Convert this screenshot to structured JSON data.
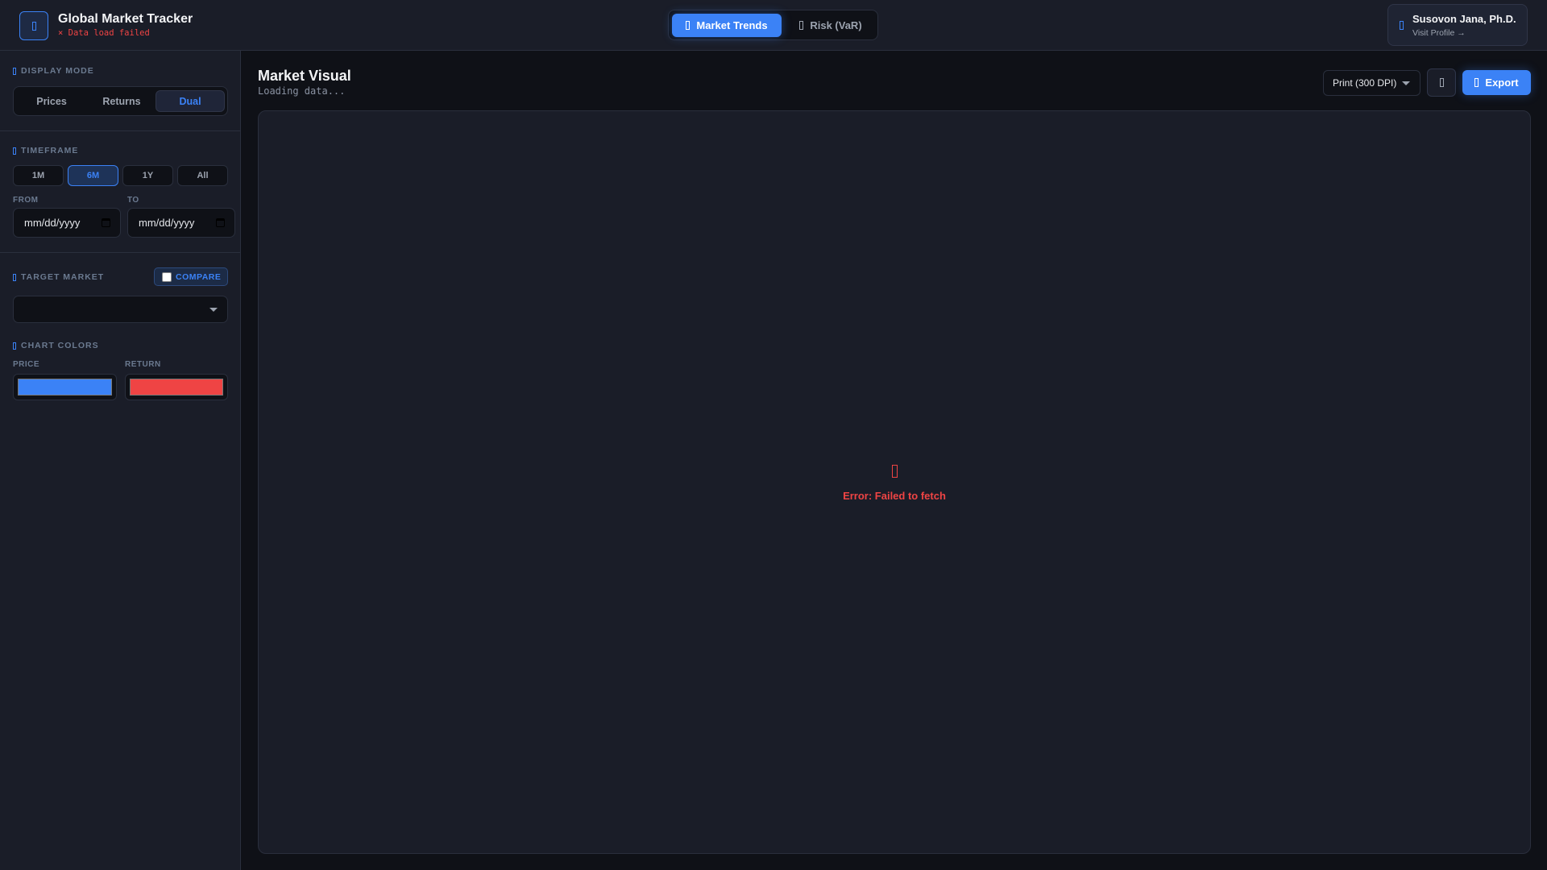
{
  "header": {
    "logo_icon": "chart-icon",
    "title": "Global Market Tracker",
    "status": "× Data load failed",
    "tabs": [
      {
        "label": "Market Trends",
        "icon": "trend-icon",
        "active": true
      },
      {
        "label": "Risk (VaR)",
        "icon": "shield-icon",
        "active": false
      }
    ],
    "profile": {
      "icon": "user-icon",
      "name": "Susovon Jana, Ph.D.",
      "link": "Visit Profile →"
    }
  },
  "sidebar": {
    "display_mode": {
      "label": "DISPLAY MODE",
      "options": [
        "Prices",
        "Returns",
        "Dual"
      ],
      "selected": "Dual"
    },
    "timeframe": {
      "label": "TIMEFRAME",
      "options": [
        "1M",
        "6M",
        "1Y",
        "All"
      ],
      "selected": "6M",
      "from_label": "FROM",
      "to_label": "TO",
      "from_value": "mm/dd/yyyy",
      "to_value": "mm/dd/yyyy"
    },
    "target_market": {
      "label": "TARGET MARKET",
      "compare_label": "COMPARE",
      "compare_checked": false,
      "selected": ""
    },
    "chart_colors": {
      "label": "CHART COLORS",
      "price_label": "PRICE",
      "return_label": "RETURN",
      "price_color": "#3b82f6",
      "return_color": "#ef4444"
    }
  },
  "main": {
    "title": "Market Visual",
    "status": "Loading data...",
    "export_preset": "Print (300 DPI)",
    "export_label": "Export",
    "error": "Error: Failed to fetch"
  }
}
